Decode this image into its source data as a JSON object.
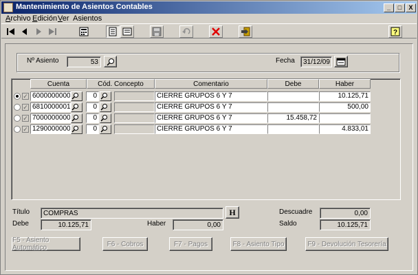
{
  "window": {
    "title": "Mantenimiento de Asientos Contables",
    "controls": {
      "minimize": "_",
      "maximize": "□",
      "close": "X"
    }
  },
  "menu": [
    {
      "label": "Archivo",
      "key": "A",
      "rest": "rchivo"
    },
    {
      "label": "Edición",
      "key": "E",
      "rest": "dición"
    },
    {
      "label": "Ver",
      "key": "V",
      "rest": "er"
    },
    {
      "label": "Asientos",
      "key": "",
      "rest": "Asientos"
    }
  ],
  "toolbar": {
    "icons": [
      "first-record-icon",
      "previous-record-icon",
      "next-record-icon",
      "last-record-icon",
      "calculator-icon",
      "form-view-icon",
      "toggle-view-icon",
      "save-icon",
      "undo-icon",
      "delete-icon",
      "exit-icon",
      "help-icon"
    ]
  },
  "header": {
    "asiento_label": "Nº Asiento",
    "asiento_value": "53",
    "fecha_label": "Fecha",
    "fecha_value": "31/12/09"
  },
  "grid": {
    "columns": [
      "Cuenta",
      "Cód. Concepto",
      "Comentario",
      "Debe",
      "Haber"
    ],
    "rows": [
      {
        "selected": true,
        "checked": true,
        "cuenta": "6000000000",
        "concepto": "0",
        "comentario": "CIERRE GRUPOS 6 Y 7",
        "debe": "",
        "haber": "10.125,71"
      },
      {
        "selected": false,
        "checked": true,
        "cuenta": "6810000001",
        "concepto": "0",
        "comentario": "CIERRE GRUPOS 6 Y 7",
        "debe": "",
        "haber": "500,00"
      },
      {
        "selected": false,
        "checked": true,
        "cuenta": "7000000000",
        "concepto": "0",
        "comentario": "CIERRE GRUPOS 6 Y 7",
        "debe": "15.458,72",
        "haber": ""
      },
      {
        "selected": false,
        "checked": true,
        "cuenta": "1290000000",
        "concepto": "0",
        "comentario": "CIERRE GRUPOS 6 Y 7",
        "debe": "",
        "haber": "4.833,01"
      }
    ]
  },
  "footer": {
    "titulo_label": "Título",
    "titulo_value": "COMPRAS",
    "h_button": "H",
    "descuadre_label": "Descuadre",
    "descuadre_value": "0,00",
    "debe_label": "Debe",
    "debe_value": "10.125,71",
    "haber_label": "Haber",
    "haber_value": "0,00",
    "saldo_label": "Saldo",
    "saldo_value": "10.125,71"
  },
  "actions": [
    {
      "label": "F5 - Asiento Automático"
    },
    {
      "label": "F6 - Cobros"
    },
    {
      "label": "F7 - Pagos"
    },
    {
      "label": "F8 - Asiento Tipo"
    },
    {
      "label": "F9 - Devolución Tesorería"
    }
  ]
}
